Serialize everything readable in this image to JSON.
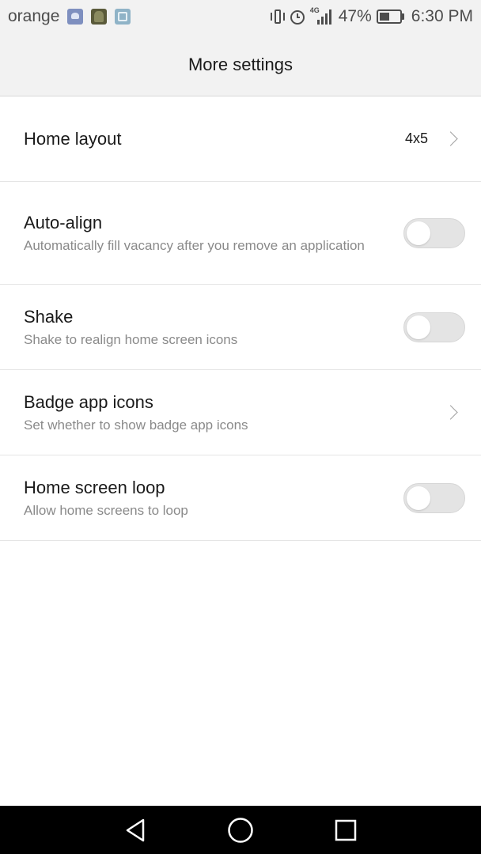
{
  "status_bar": {
    "carrier": "orange",
    "notification_icons": [
      "health-icon",
      "photo-thumbnail-icon",
      "gallery-icon"
    ],
    "network": "4G",
    "battery_percent": "47%",
    "time": "6:30 PM"
  },
  "header": {
    "title": "More settings"
  },
  "settings": [
    {
      "title": "Home layout",
      "subtitle": "",
      "value": "4x5",
      "control": "chevron"
    },
    {
      "title": "Auto-align",
      "subtitle": "Automatically fill vacancy after you remove an application",
      "control": "toggle",
      "on": false
    },
    {
      "title": "Shake",
      "subtitle": "Shake to realign home screen icons",
      "control": "toggle",
      "on": false
    },
    {
      "title": "Badge app icons",
      "subtitle": "Set whether to show badge app icons",
      "control": "chevron"
    },
    {
      "title": "Home screen loop",
      "subtitle": "Allow home screens to loop",
      "control": "toggle",
      "on": false
    }
  ],
  "nav_bar": {
    "buttons": [
      "back-icon",
      "home-icon",
      "recents-icon"
    ]
  },
  "colors": {
    "header_bg": "#f2f2f2",
    "toggle_off": "#e4e4e4",
    "subtitle_text": "#8a8a8a",
    "nav_bg": "#000000"
  }
}
